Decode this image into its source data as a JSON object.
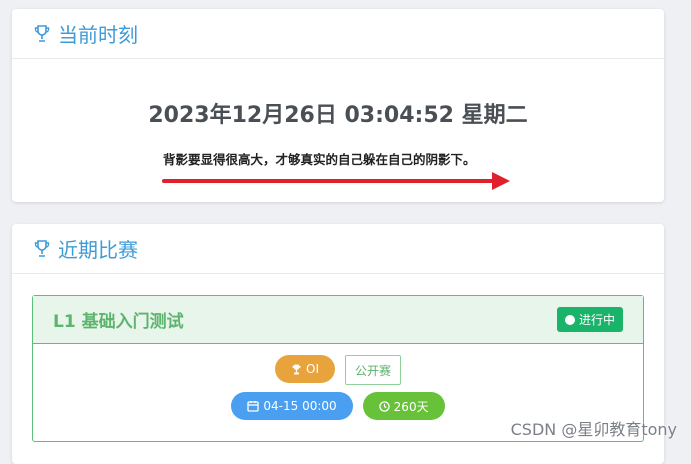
{
  "clock_card": {
    "title": "当前时刻",
    "time_text": "2023年12月26日 03:04:52 星期二",
    "quote": "背影要显得很高大，才够真实的自己躲在自己的阴影下。"
  },
  "contest_card": {
    "title": "近期比赛",
    "contest": {
      "name": "L1 基础入门测试",
      "status": "进行中",
      "rule": "OI",
      "visibility": "公开赛",
      "start": "04-15 00:00",
      "duration": "260天"
    }
  },
  "watermark": "CSDN @星卯教育tony",
  "colors": {
    "accent": "#3f9bd8",
    "status_green": "#19b46a",
    "oi_orange": "#e8a33d",
    "date_blue": "#4a9ff0",
    "duration_green": "#67c23a",
    "arrow_red": "#e0202a"
  },
  "icons": {
    "card_header": "trophy-icon",
    "status": "dot-icon",
    "rule": "trophy-icon",
    "date": "calendar-icon",
    "duration": "clock-icon"
  }
}
